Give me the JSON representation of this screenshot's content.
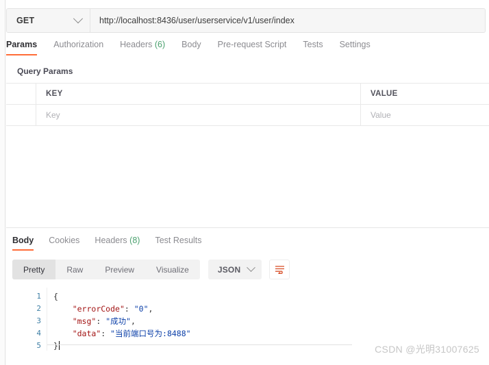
{
  "request": {
    "method": "GET",
    "url": "http://localhost:8436/user/userservice/v1/user/index",
    "tabs": [
      {
        "label": "Params",
        "active": true
      },
      {
        "label": "Authorization",
        "active": false
      },
      {
        "label": "Headers",
        "count": "(6)",
        "active": false
      },
      {
        "label": "Body",
        "active": false
      },
      {
        "label": "Pre-request Script",
        "active": false
      },
      {
        "label": "Tests",
        "active": false
      },
      {
        "label": "Settings",
        "active": false
      }
    ]
  },
  "query_params": {
    "section_title": "Query Params",
    "columns": [
      "KEY",
      "VALUE"
    ],
    "rows": [
      {
        "key_placeholder": "Key",
        "value_placeholder": "Value"
      }
    ]
  },
  "response": {
    "tabs": [
      {
        "label": "Body",
        "active": true
      },
      {
        "label": "Cookies",
        "active": false
      },
      {
        "label": "Headers",
        "count": "(8)",
        "active": false
      },
      {
        "label": "Test Results",
        "active": false
      }
    ],
    "views": [
      {
        "label": "Pretty",
        "active": true
      },
      {
        "label": "Raw",
        "active": false
      },
      {
        "label": "Preview",
        "active": false
      },
      {
        "label": "Visualize",
        "active": false
      }
    ],
    "format": "JSON",
    "body_lines": [
      {
        "num": "1",
        "text": "{"
      },
      {
        "num": "2",
        "text": "    \"errorCode\": \"0\","
      },
      {
        "num": "3",
        "text": "    \"msg\": \"成功\","
      },
      {
        "num": "4",
        "text": "    \"data\": \"当前端口号为:8488\""
      },
      {
        "num": "5",
        "text": "}"
      }
    ],
    "json": {
      "errorCode": "0",
      "msg": "成功",
      "data": "当前端口号为:8488"
    }
  },
  "watermark": "CSDN @光明31007625",
  "colors": {
    "accent": "#ff6c37",
    "count_green": "#4aa06e",
    "json_key": "#a31515",
    "json_string": "#0b3fa8",
    "line_number": "#3f7fa5"
  }
}
